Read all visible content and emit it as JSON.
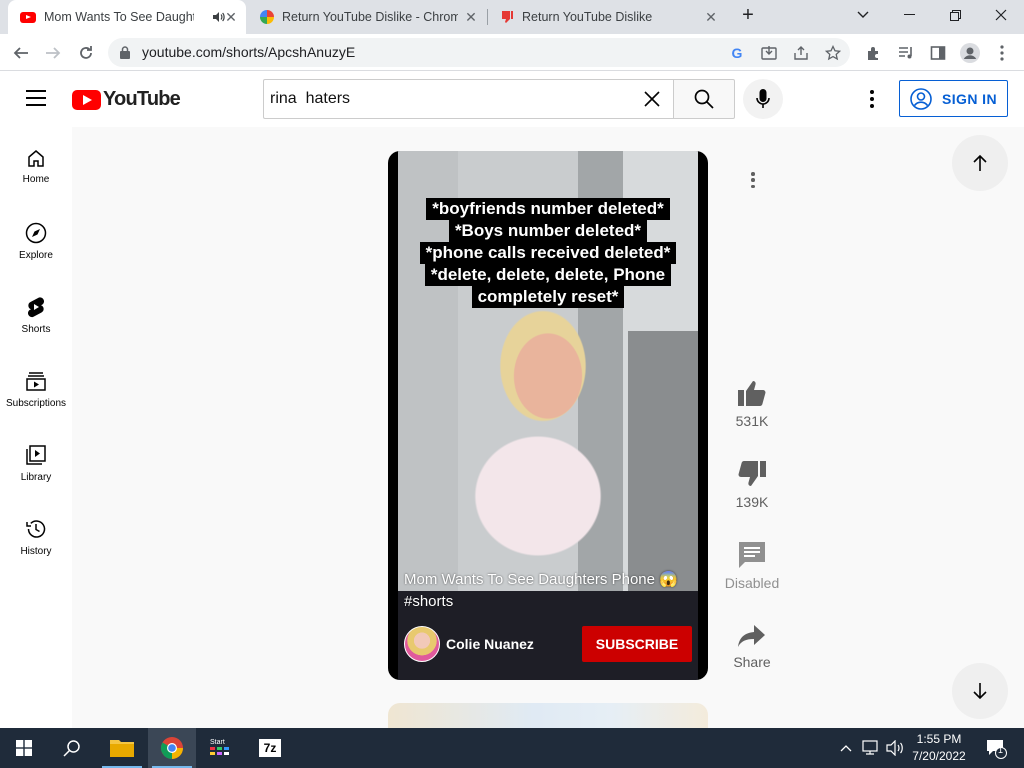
{
  "browser": {
    "tabs": [
      {
        "title": "Mom Wants To See Daughte",
        "favicon": "youtube-icon",
        "active": true,
        "audio": true
      },
      {
        "title": "Return YouTube Dislike - Chrome",
        "favicon": "chrome-web-store-icon",
        "active": false
      },
      {
        "title": "Return YouTube Dislike",
        "favicon": "dislike-icon",
        "active": false
      }
    ],
    "url": "youtube.com/shorts/ApcshAnuzyE"
  },
  "header": {
    "logo_text": "YouTube",
    "search_value": "rina  haters",
    "sign_in_label": "SIGN IN"
  },
  "sidebar": {
    "items": [
      {
        "label": "Home",
        "icon": "home-icon"
      },
      {
        "label": "Explore",
        "icon": "compass-icon"
      },
      {
        "label": "Shorts",
        "icon": "shorts-icon"
      },
      {
        "label": "Subscriptions",
        "icon": "subscriptions-icon"
      },
      {
        "label": "Library",
        "icon": "library-icon"
      },
      {
        "label": "History",
        "icon": "history-icon"
      }
    ]
  },
  "short": {
    "overlay_lines": [
      "*boyfriends number deleted*",
      "*Boys number deleted*",
      "*phone calls received deleted*",
      "*delete, delete, delete, Phone",
      "completely reset*"
    ],
    "title": "Mom Wants To See Daughters Phone 😱 #shorts",
    "channel": "Colie Nuanez",
    "subscribe_label": "SUBSCRIBE",
    "likes": "531K",
    "dislikes": "139K",
    "comments_label": "Disabled",
    "share_label": "Share"
  },
  "taskbar": {
    "time": "1:55 PM",
    "date": "7/20/2022",
    "notification_count": "1"
  },
  "colors": {
    "youtube_red": "#ff0000",
    "subscribe_red": "#cc0000",
    "sign_in_blue": "#065fd4",
    "taskbar": "#1f2b3a"
  }
}
